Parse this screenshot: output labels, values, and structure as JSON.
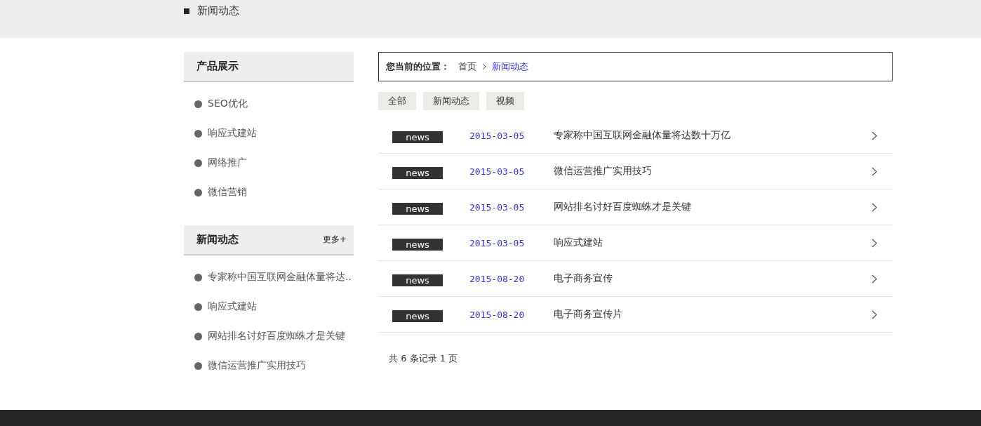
{
  "page_banner": {
    "title": "新闻动态"
  },
  "sidebar": {
    "sections": [
      {
        "title": "产品展示",
        "items": [
          "SEO优化",
          "响应式建站",
          "网络推广",
          "微信营销"
        ]
      },
      {
        "title": "新闻动态",
        "more": "更多+",
        "items": [
          "专家称中国互联网金融体量将达..",
          "响应式建站",
          "网站排名讨好百度蜘蛛才是关键",
          "微信运营推广实用技巧"
        ]
      }
    ]
  },
  "breadcrumb": {
    "label": "您当前的位置：",
    "items": [
      {
        "text": "首页",
        "selected": false
      },
      {
        "text": "新闻动态",
        "selected": true
      }
    ]
  },
  "filters": [
    {
      "label": "全部",
      "selected": false
    },
    {
      "label": "新闻动态",
      "selected": false
    },
    {
      "label": "视频",
      "selected": false
    }
  ],
  "news_list": [
    {
      "tag": "news",
      "date": "2015-03-05",
      "title": "专家称中国互联网金融体量将达数十万亿"
    },
    {
      "tag": "news",
      "date": "2015-03-05",
      "title": "微信运营推广实用技巧"
    },
    {
      "tag": "news",
      "date": "2015-03-05",
      "title": "网站排名讨好百度蜘蛛才是关键"
    },
    {
      "tag": "news",
      "date": "2015-03-05",
      "title": "响应式建站"
    },
    {
      "tag": "news",
      "date": "2015-08-20",
      "title": "电子商务宣传"
    },
    {
      "tag": "news",
      "date": "2015-08-20",
      "title": "电子商务宣传片"
    }
  ],
  "pagination": "共 6 条记录 1 页"
}
